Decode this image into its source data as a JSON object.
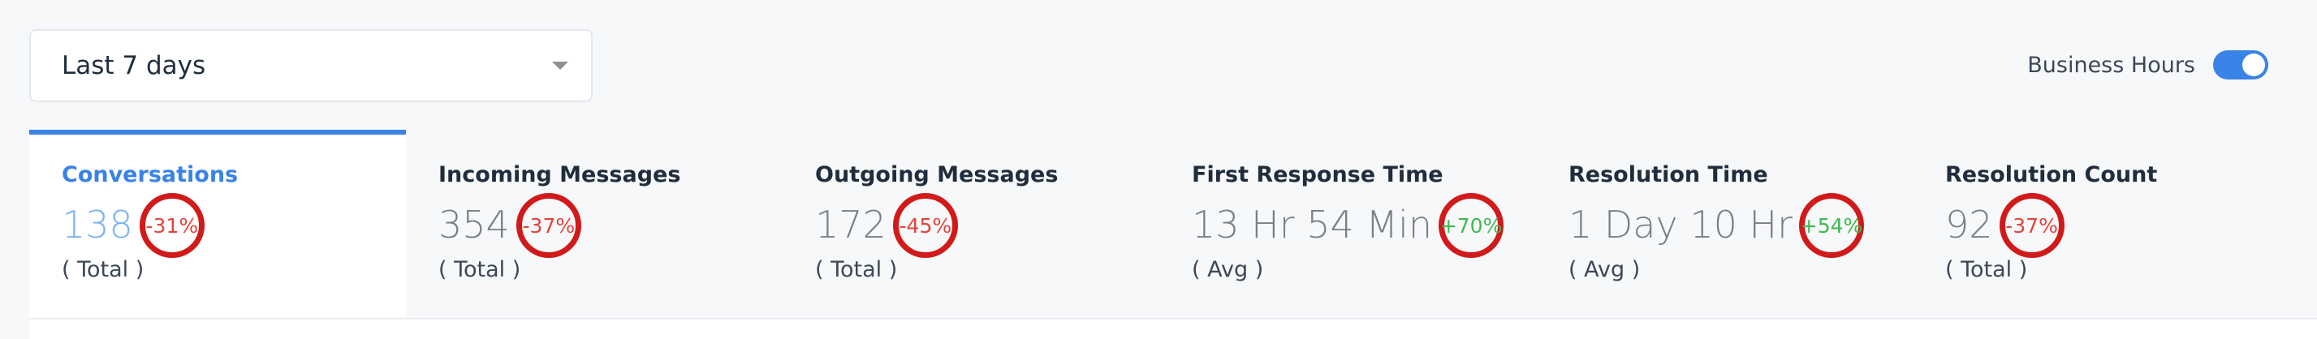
{
  "date_filter": {
    "selected": "Last 7 days"
  },
  "business_hours": {
    "label": "Business Hours",
    "enabled": true,
    "color": "#3a83e6"
  },
  "metrics": [
    {
      "title": "Conversations",
      "value": "138",
      "change": "-31%",
      "trend": "negative",
      "sub": "( Total )",
      "active": true
    },
    {
      "title": "Incoming Messages",
      "value": "354",
      "change": "-37%",
      "trend": "negative",
      "sub": "( Total )",
      "active": false
    },
    {
      "title": "Outgoing Messages",
      "value": "172",
      "change": "-45%",
      "trend": "negative",
      "sub": "( Total )",
      "active": false
    },
    {
      "title": "First Response Time",
      "value": "13 Hr 54 Min",
      "change": "+70%",
      "trend": "positive",
      "sub": "( Avg )",
      "active": false
    },
    {
      "title": "Resolution Time",
      "value": "1 Day 10 Hr",
      "change": "+54%",
      "trend": "positive",
      "sub": "( Avg )",
      "active": false
    },
    {
      "title": "Resolution Count",
      "value": "92",
      "change": "-37%",
      "trend": "negative",
      "sub": "( Total )",
      "active": false
    }
  ],
  "colors": {
    "accent": "#3a83e6",
    "negative": "#e5433a",
    "positive": "#3fb950",
    "highlight_ring": "#d11a1a"
  }
}
